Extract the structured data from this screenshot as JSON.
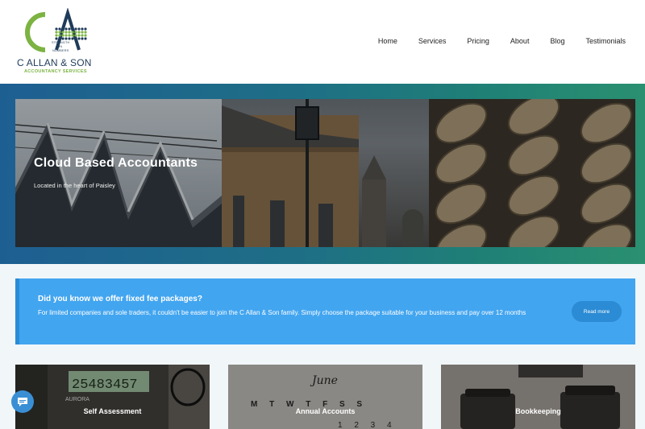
{
  "brand": {
    "logo_letters": "CA",
    "tagline_line1": "STRENGTH",
    "tagline_line2": "IN",
    "tagline_line3": "NUMBERS",
    "name": "C ALLAN & SON",
    "subtitle": "ACCOUNTANCY SERVICES",
    "colors": {
      "navy": "#1f3b5a",
      "green": "#7cb342"
    }
  },
  "nav": {
    "items": [
      {
        "label": "Home"
      },
      {
        "label": "Services"
      },
      {
        "label": "Pricing"
      },
      {
        "label": "About"
      },
      {
        "label": "Blog"
      },
      {
        "label": "Testimonials"
      }
    ]
  },
  "hero": {
    "title": "Cloud Based Accountants",
    "subtitle": "Located in the heart of Paisley"
  },
  "notice": {
    "title": "Did you know we offer fixed fee packages?",
    "text": "For limited companies and sole traders, it couldn't be easier to join the C Allan & Son family. Simply choose the package suitable for your business and pay over 12 months",
    "button": "Read more",
    "color": "#42a5f0"
  },
  "cards": [
    {
      "title": "Self Assessment",
      "calc_display": "25483457",
      "calc_brand": "AURORA"
    },
    {
      "title": "Annual Accounts",
      "month": "June",
      "weekdays": "M T W T F S S",
      "dates": "1 2 3 4"
    },
    {
      "title": "Bookkeeping"
    }
  ],
  "chat": {
    "icon": "chat-icon"
  }
}
